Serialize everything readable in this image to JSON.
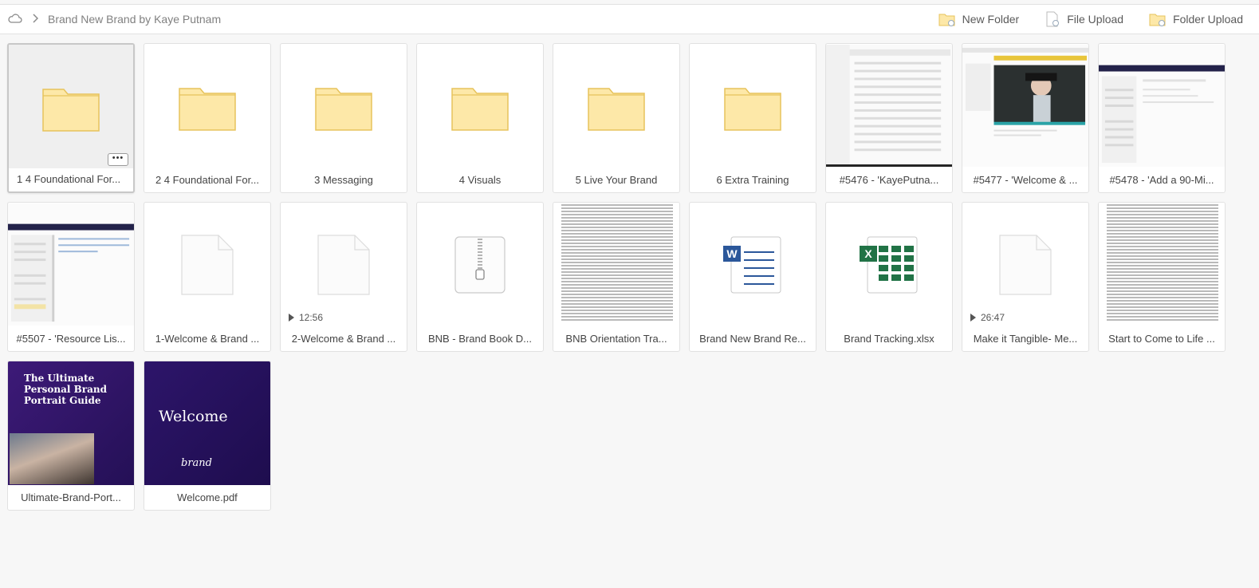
{
  "breadcrumb": {
    "title": "Brand New Brand by Kaye Putnam"
  },
  "toolbar": {
    "new_folder": "New Folder",
    "file_upload": "File Upload",
    "folder_upload": "Folder Upload"
  },
  "colors": {
    "folder": "#fde8a8",
    "folder_stroke": "#e7c35c",
    "word": "#2b579a",
    "excel": "#217346",
    "portrait_bg": "#31166a"
  },
  "row1": [
    {
      "name": "1 4 Foundational For...",
      "type": "folder"
    },
    {
      "name": "2 4 Foundational For...",
      "type": "folder"
    },
    {
      "name": "3 Messaging",
      "type": "folder"
    },
    {
      "name": "4 Visuals",
      "type": "folder"
    },
    {
      "name": "5 Live Your Brand",
      "type": "folder"
    },
    {
      "name": "6 Extra Training",
      "type": "folder"
    },
    {
      "name": "#5476 - 'KayePutna...",
      "type": "screenshot"
    },
    {
      "name": "#5477 - 'Welcome & ...",
      "type": "screenshot"
    },
    {
      "name": "#5478 - 'Add a 90-Mi...",
      "type": "screenshot"
    }
  ],
  "row2": [
    {
      "name": "#5507 - 'Resource Lis...",
      "type": "screenshot"
    },
    {
      "name": "1-Welcome & Brand ...",
      "type": "file"
    },
    {
      "name": "2-Welcome & Brand ...",
      "type": "video",
      "duration": "12:56"
    },
    {
      "name": "BNB - Brand Book D...",
      "type": "zip"
    },
    {
      "name": "BNB Orientation Tra...",
      "type": "document"
    },
    {
      "name": "Brand New Brand Re...",
      "type": "word"
    },
    {
      "name": "Brand Tracking.xlsx",
      "type": "excel"
    },
    {
      "name": "Make it Tangible- Me...",
      "type": "video",
      "duration": "26:47"
    },
    {
      "name": "Start to Come to Life ...",
      "type": "document"
    }
  ],
  "row3": [
    {
      "name": "Ultimate-Brand-Port...",
      "type": "pdf",
      "cover_title": "The Ultimate Personal Brand Portrait Guide"
    },
    {
      "name": "Welcome.pdf",
      "type": "pdf",
      "cover_title": "Welcome",
      "cover_mark": "brand"
    }
  ],
  "icons": {
    "cloud": "cloud-icon",
    "chevron": "chevron-right-icon",
    "more": "more-options-icon"
  }
}
